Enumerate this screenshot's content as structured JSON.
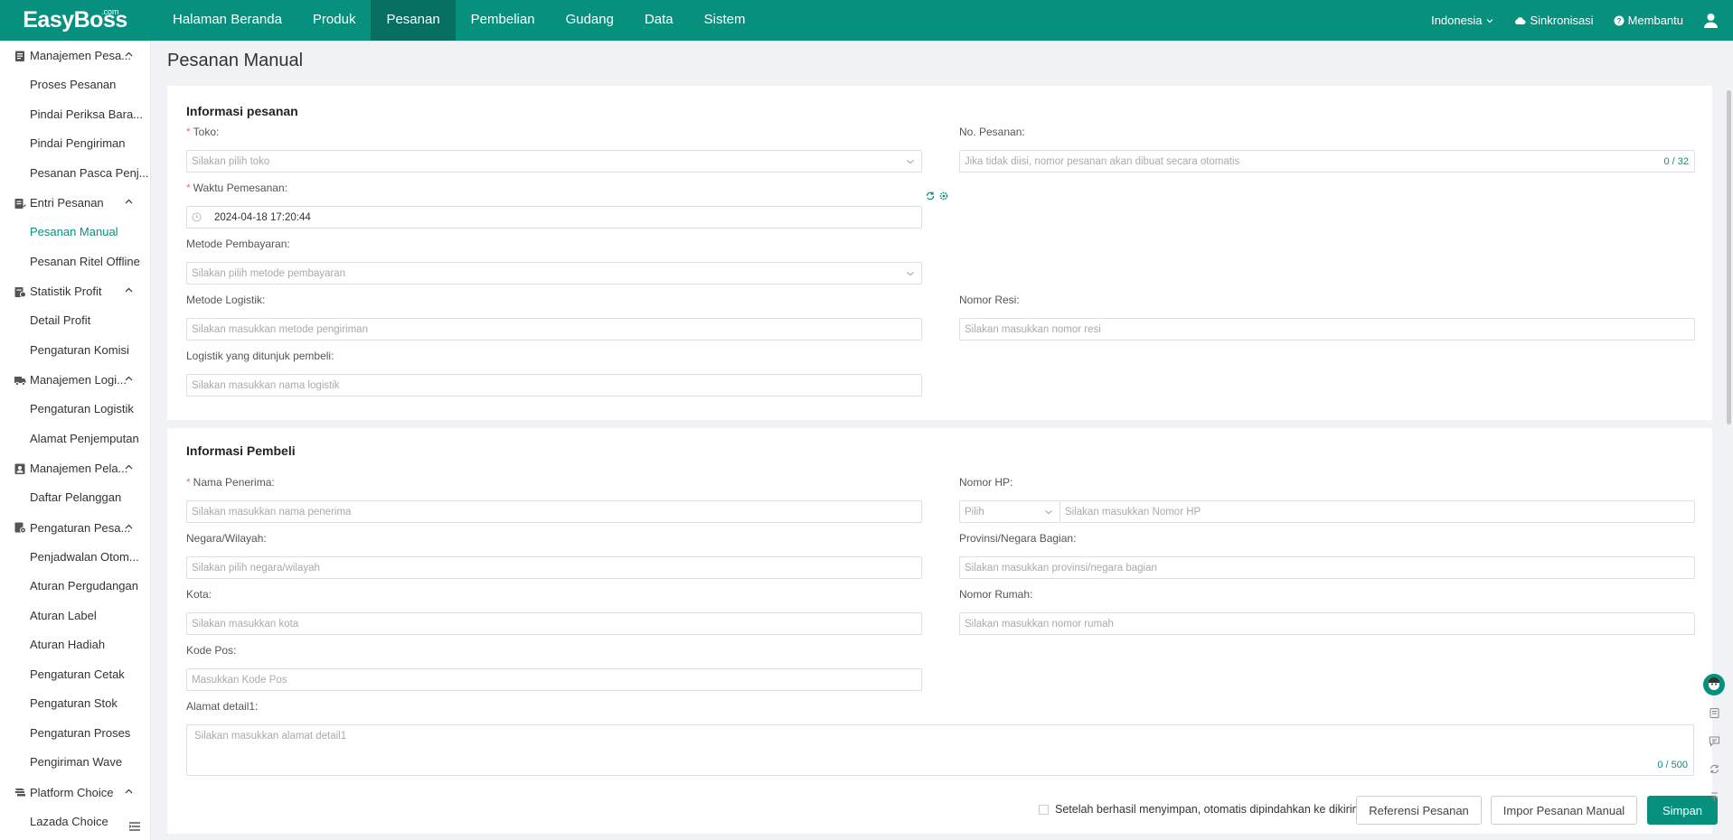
{
  "brand": {
    "name": "EasyBoss",
    "suffix": ".com"
  },
  "nav": [
    "Halaman Beranda",
    "Produk",
    "Pesanan",
    "Pembelian",
    "Gudang",
    "Data",
    "Sistem"
  ],
  "nav_active": "Pesanan",
  "topright": {
    "language": "Indonesia",
    "sync": "Sinkronisasi",
    "help": "Membantu"
  },
  "sidebar": [
    {
      "label": "Manajemen Pesa...",
      "icon": "clipboard-icon",
      "items": [
        "Proses Pesanan",
        "Pindai Periksa Bara...",
        "Pindai Pengiriman",
        "Pesanan Pasca Penj..."
      ]
    },
    {
      "label": "Entri Pesanan",
      "icon": "entry-icon",
      "items": [
        "Pesanan Manual",
        "Pesanan Ritel Offline"
      ]
    },
    {
      "label": "Statistik Profit",
      "icon": "stats-icon",
      "items": [
        "Detail Profit",
        "Pengaturan Komisi"
      ]
    },
    {
      "label": "Manajemen Logi...",
      "icon": "truck-icon",
      "items": [
        "Pengaturan Logistik",
        "Alamat Penjemputan"
      ]
    },
    {
      "label": "Manajemen Pela...",
      "icon": "customer-icon",
      "items": [
        "Daftar Pelanggan"
      ]
    },
    {
      "label": "Pengaturan Pesa...",
      "icon": "order-settings-icon",
      "items": [
        "Penjadwalan Otom...",
        "Aturan Pergudangan",
        "Aturan Label",
        "Aturan Hadiah",
        "Pengaturan Cetak",
        "Pengaturan Stok",
        "Pengaturan Proses",
        "Pengiriman Wave"
      ]
    },
    {
      "label": "Platform Choice",
      "icon": "platform-icon",
      "items": [
        "Lazada Choice"
      ]
    }
  ],
  "sidebar_active": "Pesanan Manual",
  "page_title": "Pesanan Manual",
  "order_info": {
    "title": "Informasi pesanan",
    "store": {
      "label": "Toko:",
      "placeholder": "Silakan pilih toko"
    },
    "order_no": {
      "label": "No. Pesanan:",
      "placeholder": "Jika tidak diisi, nomor pesanan akan dibuat secara otomatis",
      "counter": "0 / 32"
    },
    "order_time": {
      "label": "Waktu Pemesanan:",
      "value": "2024-04-18 17:20:44"
    },
    "payment": {
      "label": "Metode Pembayaran:",
      "placeholder": "Silakan pilih metode pembayaran"
    },
    "logistics": {
      "label": "Metode Logistik:",
      "placeholder": "Silakan masukkan metode pengiriman"
    },
    "tracking": {
      "label": "Nomor Resi:",
      "placeholder": "Silakan masukkan nomor resi"
    },
    "buyer_logistics": {
      "label": "Logistik yang ditunjuk pembeli:",
      "placeholder": "Silakan masukkan nama logistik"
    }
  },
  "buyer_info": {
    "title": "Informasi Pembeli",
    "recipient": {
      "label": "Nama Penerima:",
      "placeholder": "Silakan masukkan nama penerima"
    },
    "phone": {
      "label": "Nomor HP:",
      "code_placeholder": "Pilih",
      "placeholder": "Silakan masukkan Nomor HP"
    },
    "country": {
      "label": "Negara/Wilayah:",
      "placeholder": "Silakan pilih negara/wilayah"
    },
    "province": {
      "label": "Provinsi/Negara Bagian:",
      "placeholder": "Silakan masukkan provinsi/negara bagian"
    },
    "city": {
      "label": "Kota:",
      "placeholder": "Silakan masukkan kota"
    },
    "house_no": {
      "label": "Nomor Rumah:",
      "placeholder": "Silakan masukkan nomor rumah"
    },
    "postcode": {
      "label": "Kode Pos:",
      "placeholder": "Masukkan Kode Pos"
    },
    "address": {
      "label": "Alamat detail1:",
      "placeholder": "Silakan masukkan alamat detail1",
      "counter": "0 / 500"
    }
  },
  "footer": {
    "checkbox_label": "Setelah berhasil menyimpan, otomatis dipindahkan ke dikirim",
    "reference_button": "Referensi Pesanan",
    "import_button": "Impor Pesanan Manual",
    "save_button": "Simpan"
  },
  "colors": {
    "brand": "#07907e",
    "nav_active": "#066f61",
    "required": "#f56c6c"
  }
}
